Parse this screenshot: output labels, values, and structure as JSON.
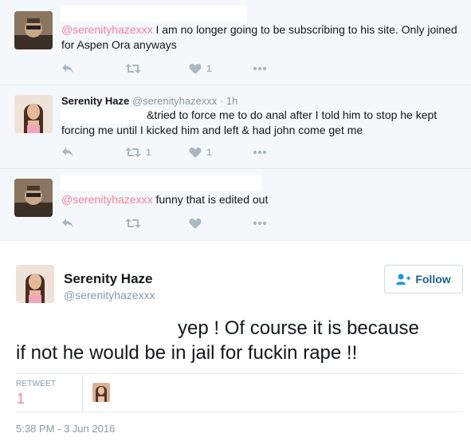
{
  "replies": [
    {
      "mention": "@serenityhazexxx",
      "text": " I am no longer going to be subscribing to his site. Only joined for Aspen Ora anyways",
      "likes": "1"
    },
    {
      "name": "Serenity Haze",
      "handle": "@serenityhazexxx",
      "time": "· 1h",
      "line1": "&tried to force me to do anal after I told him to stop he kept",
      "line2": "forcing me until I kicked him and left & had john come get me",
      "retweets": "1",
      "likes": "1"
    },
    {
      "mention": "@serenityhazexxx",
      "text": " funny that is edited out"
    }
  ],
  "main": {
    "name": "Serenity Haze",
    "handle": "@serenityhazexxx",
    "follow_label": "Follow",
    "body_line1": "yep ! Of course it is because",
    "body_line2": "if not he would be in jail for fuckin  rape !!",
    "retweet_label": "RETWEET",
    "retweet_count": "1",
    "timestamp": "5:38 PM - 3 Jun 2016"
  },
  "colors": {
    "accent_pink": "#f57fa1",
    "muted": "#8899a6",
    "follow_blue": "#1b5f8c"
  }
}
